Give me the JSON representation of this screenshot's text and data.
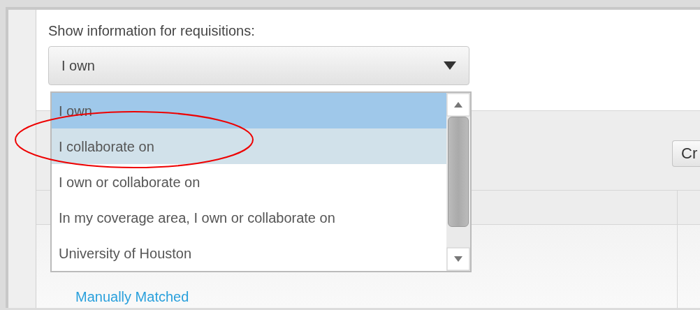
{
  "filter": {
    "label": "Show information for requisitions:",
    "value": "I own"
  },
  "options": [
    {
      "label": "I own",
      "selected": true,
      "highlighted": false
    },
    {
      "label": "I collaborate on",
      "selected": false,
      "highlighted": true
    },
    {
      "label": "I own or collaborate on",
      "selected": false,
      "highlighted": false
    },
    {
      "label": "In my coverage area, I own or collaborate on",
      "selected": false,
      "highlighted": false
    },
    {
      "label": "University of Houston",
      "selected": false,
      "highlighted": false
    }
  ],
  "toolbar": {
    "button": "Cr"
  },
  "links": [
    "Manually Matched"
  ],
  "annotations": [
    {
      "kind": "ellipse"
    }
  ]
}
